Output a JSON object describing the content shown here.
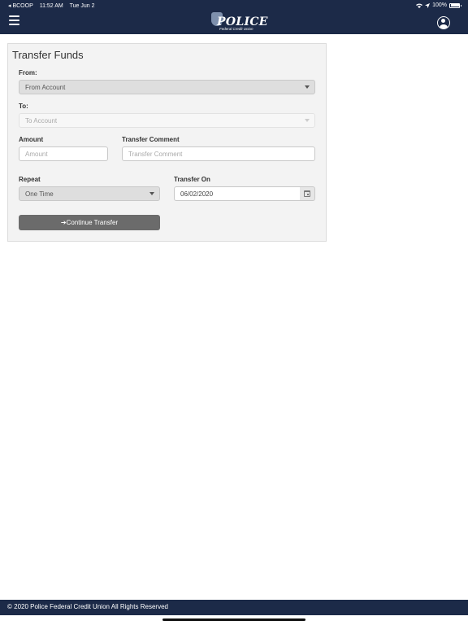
{
  "status_bar": {
    "carrier": "◂ BCOOP",
    "time": "11:52 AM",
    "date": "Tue Jun 2",
    "battery": "100%"
  },
  "header": {
    "logo_text": "POLICE",
    "logo_subtext": "Federal Credit Union"
  },
  "form": {
    "title": "Transfer Funds",
    "from_label": "From:",
    "from_value": "From Account",
    "to_label": "To:",
    "to_value": "To Account",
    "amount_label": "Amount",
    "amount_placeholder": "Amount",
    "comment_label": "Transfer Comment",
    "comment_placeholder": "Transfer Comment",
    "repeat_label": "Repeat",
    "repeat_value": "One Time",
    "transfer_on_label": "Transfer On",
    "transfer_on_value": "06/02/2020",
    "continue_label": "➔Continue Transfer"
  },
  "footer": {
    "text": "© 2020 Police Federal Credit Union All Rights Reserved"
  },
  "icons": [
    "menu-icon",
    "profile-icon",
    "caret-down-icon",
    "calendar-icon",
    "wifi-icon",
    "battery-icon"
  ],
  "colors": {
    "header_bg": "#1c2a48",
    "button_bg": "#6b6b6b",
    "panel_bg": "#f3f3f3"
  }
}
